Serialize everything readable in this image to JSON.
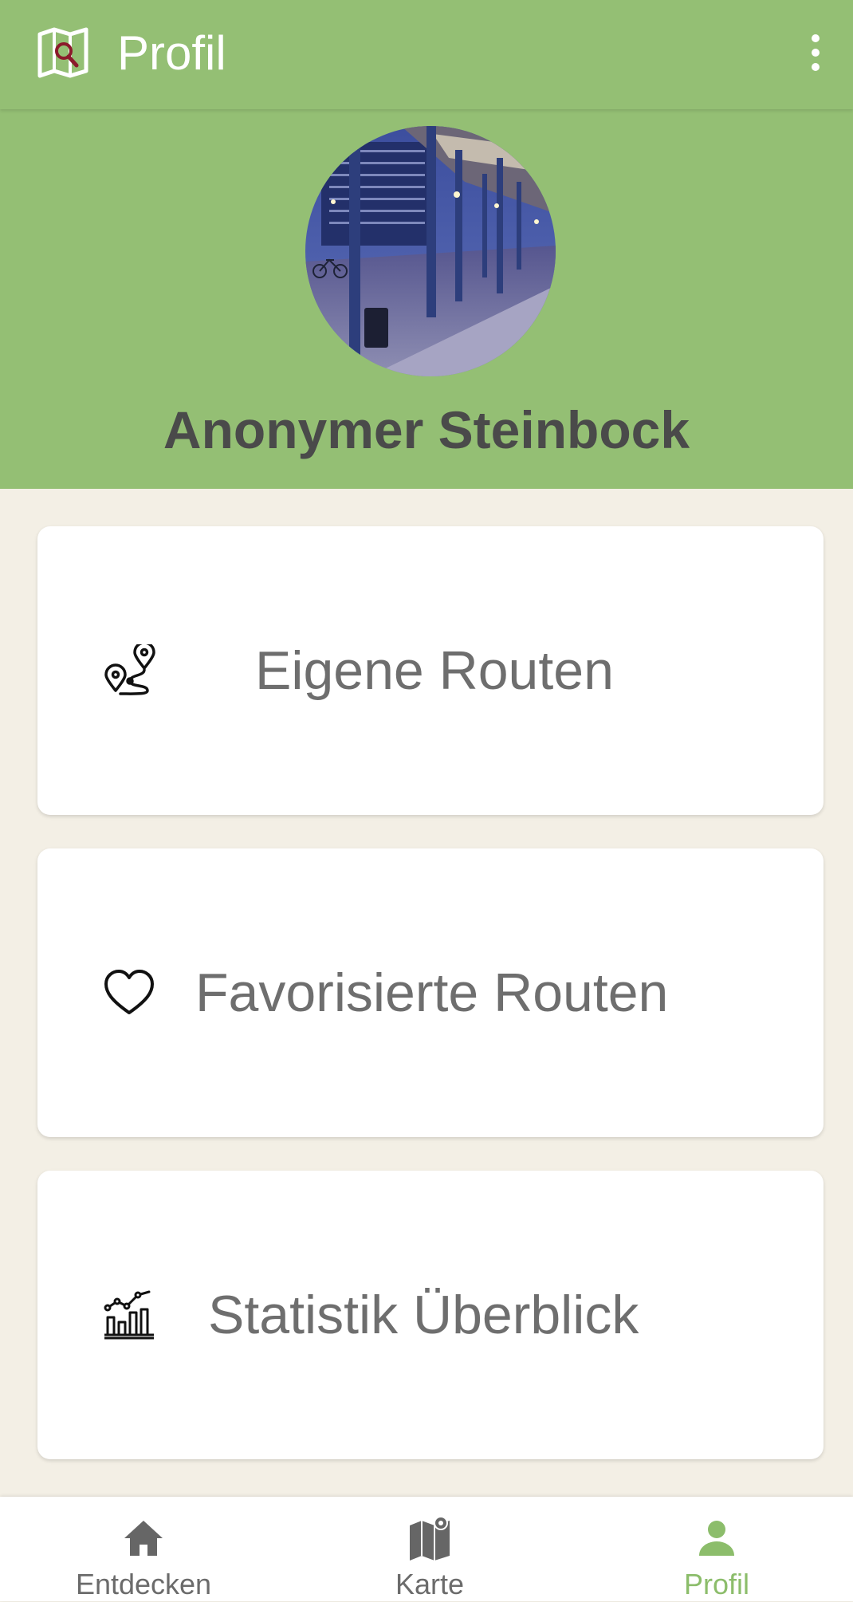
{
  "app_bar": {
    "title": "Profil",
    "logo_icon": "map-search-icon",
    "menu_icon": "more-vert-icon"
  },
  "profile": {
    "avatar_icon": "avatar-photo",
    "name": "Anonymer Steinbock"
  },
  "menu_cards": [
    {
      "label": "Eigene Routen",
      "icon": "route-icon"
    },
    {
      "label": "Favorisierte Routen",
      "icon": "heart-icon"
    },
    {
      "label": "Statistik Überblick",
      "icon": "statistics-chart-icon"
    }
  ],
  "bottom_nav": {
    "items": [
      {
        "label": "Entdecken",
        "icon": "home-icon",
        "active": false
      },
      {
        "label": "Karte",
        "icon": "map-icon",
        "active": false
      },
      {
        "label": "Profil",
        "icon": "person-icon",
        "active": true
      }
    ]
  },
  "colors": {
    "primary_green": "#94bf74",
    "active_green": "#8cbd6b",
    "background": "#f3efe5",
    "logo_accent": "#8b1a2b",
    "text_gray": "#6e6e6e"
  }
}
